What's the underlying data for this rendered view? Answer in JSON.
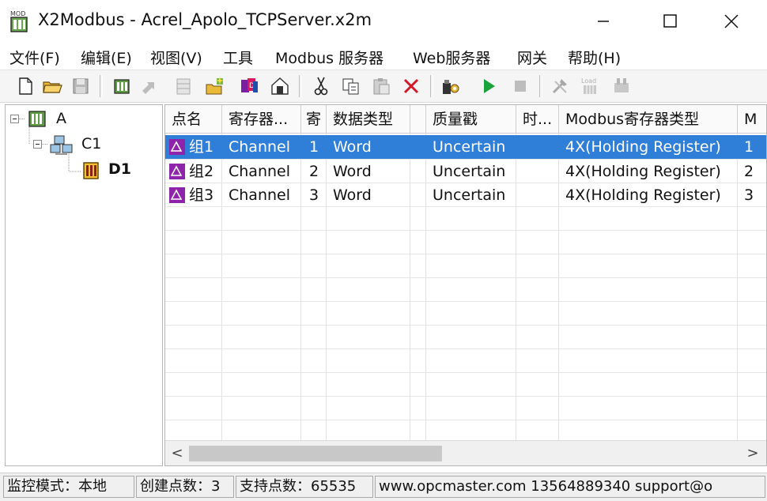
{
  "window": {
    "title": "X2Modbus - Acrel_Apolo_TCPServer.x2m",
    "app_icon": "mod-app-icon"
  },
  "menu": [
    "文件(F)",
    "编辑(E)",
    "视图(V)",
    "工具",
    "Modbus 服务器",
    "Web服务器",
    "网关",
    "帮助(H)"
  ],
  "toolbar": {
    "buttons": [
      "new-file-icon",
      "open-folder-icon",
      "save-icon",
      "add-channel-icon",
      "arrow-icon",
      "grid-icon",
      "add-group-icon",
      "add-point-icon",
      "properties-icon",
      "cut-icon",
      "copy-icon",
      "paste-icon",
      "delete-icon",
      "settings-icon",
      "run-icon",
      "stop-icon",
      "tools-icon",
      "load-icon",
      "export-icon"
    ]
  },
  "tree": {
    "root": "A",
    "channel": "C1",
    "device": "D1"
  },
  "table": {
    "columns": [
      "点名",
      "寄存器...",
      "寄",
      "数据类型",
      "",
      "质量戳",
      "时...",
      "Modbus寄存器类型",
      "M"
    ],
    "rows": [
      {
        "name": "组1",
        "register": "Channel",
        "reg_no": "1",
        "type": "Word",
        "quality": "Uncertain",
        "modbus_type": "4X(Holding Register)",
        "m": "1"
      },
      {
        "name": "组2",
        "register": "Channel",
        "reg_no": "2",
        "type": "Word",
        "quality": "Uncertain",
        "modbus_type": "4X(Holding Register)",
        "m": "2"
      },
      {
        "name": "组3",
        "register": "Channel",
        "reg_no": "3",
        "type": "Word",
        "quality": "Uncertain",
        "modbus_type": "4X(Holding Register)",
        "m": "3"
      }
    ],
    "selected_row": 0
  },
  "scrollbar": {
    "left": "<",
    "right": ">"
  },
  "status": {
    "mode": "监控模式：本地",
    "created": "创建点数：3",
    "supported": "支持点数：65535",
    "contact": "www.opcmaster.com 13564889340 support@o"
  },
  "colors": {
    "selection": "#2f7ed8",
    "run": "#1aa33a",
    "delete": "#d0192a"
  }
}
